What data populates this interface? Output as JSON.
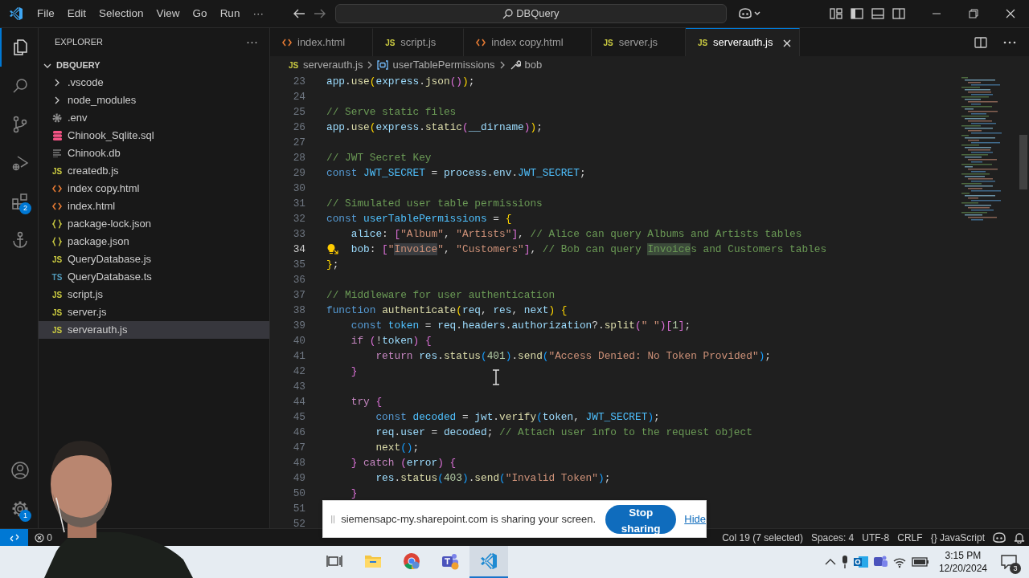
{
  "title_bar": {
    "menu": [
      "File",
      "Edit",
      "Selection",
      "View",
      "Go",
      "Run",
      "···"
    ],
    "search": "DBQuery"
  },
  "activity_bar": {
    "items": [
      {
        "kind": "files",
        "selected": true
      },
      {
        "kind": "search",
        "selected": false
      },
      {
        "kind": "source-control",
        "selected": false
      },
      {
        "kind": "run-debug",
        "selected": false
      },
      {
        "kind": "extensions",
        "selected": false,
        "badge": "2"
      },
      {
        "kind": "anchor",
        "selected": false
      }
    ],
    "bottom": [
      {
        "kind": "account"
      },
      {
        "kind": "settings",
        "badge": "1"
      }
    ]
  },
  "sidebar": {
    "title": "EXPLORER",
    "more": "···",
    "folder": {
      "name": "DBQUERY",
      "expanded": true,
      "children": [
        {
          "kind": "folder",
          "name": ".vscode",
          "expanded": false,
          "selected": false
        },
        {
          "kind": "folder",
          "name": "node_modules",
          "expanded": false,
          "selected": false
        },
        {
          "kind": "gear",
          "name": ".env",
          "selected": false
        },
        {
          "kind": "database",
          "name": "Chinook_Sqlite.sql",
          "selected": false
        },
        {
          "kind": "lines",
          "name": "Chinook.db",
          "selected": false
        },
        {
          "kind": "js",
          "badge": "JS",
          "name": "createdb.js",
          "selected": false
        },
        {
          "kind": "html",
          "name": "index copy.html",
          "selected": false
        },
        {
          "kind": "html",
          "name": "index.html",
          "selected": false
        },
        {
          "kind": "json",
          "name": "package-lock.json",
          "selected": false
        },
        {
          "kind": "json",
          "name": "package.json",
          "selected": false
        },
        {
          "kind": "js",
          "badge": "JS",
          "name": "QueryDatabase.js",
          "selected": false
        },
        {
          "kind": "ts",
          "badge": "TS",
          "name": "QueryDatabase.ts",
          "selected": false
        },
        {
          "kind": "js",
          "badge": "JS",
          "name": "script.js",
          "selected": false
        },
        {
          "kind": "js",
          "badge": "JS",
          "name": "server.js",
          "selected": false
        },
        {
          "kind": "js",
          "badge": "JS",
          "name": "serverauth.js",
          "selected": true
        }
      ]
    }
  },
  "tabs": [
    {
      "kind": "html",
      "name": "index.html",
      "selected": false
    },
    {
      "kind": "js",
      "badge": "JS",
      "name": "script.js",
      "selected": false
    },
    {
      "kind": "html",
      "name": "index copy.html",
      "selected": false
    },
    {
      "kind": "js",
      "badge": "JS",
      "name": "server.js",
      "selected": false
    },
    {
      "kind": "js",
      "badge": "JS",
      "name": "serverauth.js",
      "selected": true
    }
  ],
  "breadcrumbs": [
    {
      "kind": "js",
      "badge": "JS",
      "text": "serverauth.js"
    },
    {
      "kind": "variable",
      "text": "userTablePermissions"
    },
    {
      "kind": "property",
      "text": "bob"
    }
  ],
  "editor": {
    "lines": [
      {
        "number": "23",
        "current": false,
        "lightbulb": false,
        "tokens": [
          {
            "kind": "var",
            "text": "app"
          },
          {
            "kind": "pl",
            "text": "."
          },
          {
            "kind": "fn",
            "text": "use"
          },
          {
            "kind": "b1",
            "text": "("
          },
          {
            "kind": "var",
            "text": "express"
          },
          {
            "kind": "pl",
            "text": "."
          },
          {
            "kind": "fn",
            "text": "json"
          },
          {
            "kind": "b2",
            "text": "()"
          },
          {
            "kind": "b1",
            "text": ")"
          },
          {
            "kind": "pl",
            "text": ";"
          }
        ]
      },
      {
        "number": "24",
        "current": false,
        "lightbulb": false
      },
      {
        "number": "25",
        "current": false,
        "lightbulb": false,
        "tokens": [
          {
            "kind": "cm",
            "text": "// Serve static files"
          }
        ]
      },
      {
        "number": "26",
        "current": false,
        "lightbulb": false,
        "tokens": [
          {
            "kind": "var",
            "text": "app"
          },
          {
            "kind": "pl",
            "text": "."
          },
          {
            "kind": "fn",
            "text": "use"
          },
          {
            "kind": "b1",
            "text": "("
          },
          {
            "kind": "var",
            "text": "express"
          },
          {
            "kind": "pl",
            "text": "."
          },
          {
            "kind": "fn",
            "text": "static"
          },
          {
            "kind": "b2",
            "text": "("
          },
          {
            "kind": "var",
            "text": "__dirname"
          },
          {
            "kind": "b2",
            "text": ")"
          },
          {
            "kind": "b1",
            "text": ")"
          },
          {
            "kind": "pl",
            "text": ";"
          }
        ]
      },
      {
        "number": "27",
        "current": false,
        "lightbulb": false
      },
      {
        "number": "28",
        "current": false,
        "lightbulb": false,
        "tokens": [
          {
            "kind": "cm",
            "text": "// JWT Secret Key"
          }
        ]
      },
      {
        "number": "29",
        "current": false,
        "lightbulb": false,
        "tokens": [
          {
            "kind": "kw",
            "text": "const "
          },
          {
            "kind": "cv",
            "text": "JWT_SECRET"
          },
          {
            "kind": "pl",
            "text": " = "
          },
          {
            "kind": "var",
            "text": "process"
          },
          {
            "kind": "pl",
            "text": "."
          },
          {
            "kind": "var",
            "text": "env"
          },
          {
            "kind": "pl",
            "text": "."
          },
          {
            "kind": "cv",
            "text": "JWT_SECRET"
          },
          {
            "kind": "pl",
            "text": ";"
          }
        ]
      },
      {
        "number": "30",
        "current": false,
        "lightbulb": false
      },
      {
        "number": "31",
        "current": false,
        "lightbulb": false,
        "tokens": [
          {
            "kind": "cm",
            "text": "// Simulated user table permissions"
          }
        ]
      },
      {
        "number": "32",
        "current": false,
        "lightbulb": false,
        "tokens": [
          {
            "kind": "kw",
            "text": "const "
          },
          {
            "kind": "cv",
            "text": "userTablePermissions"
          },
          {
            "kind": "pl",
            "text": " = "
          },
          {
            "kind": "b1",
            "text": "{"
          }
        ]
      },
      {
        "number": "33",
        "current": false,
        "lightbulb": false,
        "tokens": [
          {
            "kind": "var",
            "text": "    alice"
          },
          {
            "kind": "pl",
            "text": ": "
          },
          {
            "kind": "b2",
            "text": "["
          },
          {
            "kind": "str",
            "text": "\"Album\""
          },
          {
            "kind": "pl",
            "text": ", "
          },
          {
            "kind": "str",
            "text": "\"Artists\""
          },
          {
            "kind": "b2",
            "text": "]"
          },
          {
            "kind": "pl",
            "text": ", "
          },
          {
            "kind": "cm",
            "text": "// Alice can query Albums and Artists tables"
          }
        ]
      },
      {
        "number": "34",
        "current": true,
        "lightbulb": true,
        "tokens": [
          {
            "kind": "var",
            "text": "    bob"
          },
          {
            "kind": "pl",
            "text": ": "
          },
          {
            "kind": "b2",
            "text": "["
          },
          {
            "kind": "str",
            "text": "\""
          },
          {
            "kind": "sel",
            "text": "Invoice"
          },
          {
            "kind": "str",
            "text": "\""
          },
          {
            "kind": "pl",
            "text": ", "
          },
          {
            "kind": "str",
            "text": "\"Customers\""
          },
          {
            "kind": "b2",
            "text": "]"
          },
          {
            "kind": "pl",
            "text": ", "
          },
          {
            "kind": "cm",
            "text": "// Bob can query "
          },
          {
            "kind": "match",
            "text": "Invoice"
          },
          {
            "kind": "cm",
            "text": "s and Customers tables"
          }
        ]
      },
      {
        "number": "35",
        "current": false,
        "lightbulb": false,
        "tokens": [
          {
            "kind": "b1",
            "text": "}"
          },
          {
            "kind": "pl",
            "text": ";"
          }
        ]
      },
      {
        "number": "36",
        "current": false,
        "lightbulb": false
      },
      {
        "number": "37",
        "current": false,
        "lightbulb": false,
        "tokens": [
          {
            "kind": "cm",
            "text": "// Middleware for user authentication"
          }
        ]
      },
      {
        "number": "38",
        "current": false,
        "lightbulb": false,
        "tokens": [
          {
            "kind": "kw",
            "text": "function "
          },
          {
            "kind": "fn",
            "text": "authenticate"
          },
          {
            "kind": "b1",
            "text": "("
          },
          {
            "kind": "var",
            "text": "req"
          },
          {
            "kind": "pl",
            "text": ", "
          },
          {
            "kind": "var",
            "text": "res"
          },
          {
            "kind": "pl",
            "text": ", "
          },
          {
            "kind": "var",
            "text": "next"
          },
          {
            "kind": "b1",
            "text": ")"
          },
          {
            "kind": "b1",
            "text": " {"
          }
        ]
      },
      {
        "number": "39",
        "current": false,
        "lightbulb": false,
        "tokens": [
          {
            "kind": "kw",
            "text": "    const "
          },
          {
            "kind": "cv",
            "text": "token"
          },
          {
            "kind": "pl",
            "text": " = "
          },
          {
            "kind": "var",
            "text": "req"
          },
          {
            "kind": "pl",
            "text": "."
          },
          {
            "kind": "var",
            "text": "headers"
          },
          {
            "kind": "pl",
            "text": "."
          },
          {
            "kind": "var",
            "text": "authorization"
          },
          {
            "kind": "pl",
            "text": "?."
          },
          {
            "kind": "fn",
            "text": "split"
          },
          {
            "kind": "b2",
            "text": "("
          },
          {
            "kind": "str",
            "text": "\" \""
          },
          {
            "kind": "b2",
            "text": ")"
          },
          {
            "kind": "b2",
            "text": "["
          },
          {
            "kind": "num",
            "text": "1"
          },
          {
            "kind": "b2",
            "text": "]"
          },
          {
            "kind": "pl",
            "text": ";"
          }
        ]
      },
      {
        "number": "40",
        "current": false,
        "lightbulb": false,
        "tokens": [
          {
            "kind": "ctl",
            "text": "    if "
          },
          {
            "kind": "b2",
            "text": "("
          },
          {
            "kind": "pl",
            "text": "!"
          },
          {
            "kind": "var",
            "text": "token"
          },
          {
            "kind": "b2",
            "text": ")"
          },
          {
            "kind": "b2",
            "text": " {"
          }
        ]
      },
      {
        "number": "41",
        "current": false,
        "lightbulb": false,
        "tokens": [
          {
            "kind": "ctl",
            "text": "        return "
          },
          {
            "kind": "var",
            "text": "res"
          },
          {
            "kind": "pl",
            "text": "."
          },
          {
            "kind": "fn",
            "text": "status"
          },
          {
            "kind": "b3",
            "text": "("
          },
          {
            "kind": "num",
            "text": "401"
          },
          {
            "kind": "b3",
            "text": ")"
          },
          {
            "kind": "pl",
            "text": "."
          },
          {
            "kind": "fn",
            "text": "send"
          },
          {
            "kind": "b3",
            "text": "("
          },
          {
            "kind": "str",
            "text": "\"Access Denied: No Token Provided\""
          },
          {
            "kind": "b3",
            "text": ")"
          },
          {
            "kind": "pl",
            "text": ";"
          }
        ]
      },
      {
        "number": "42",
        "current": false,
        "lightbulb": false,
        "tokens": [
          {
            "kind": "b2",
            "text": "    }"
          }
        ]
      },
      {
        "number": "43",
        "current": false,
        "lightbulb": false
      },
      {
        "number": "44",
        "current": false,
        "lightbulb": false,
        "tokens": [
          {
            "kind": "ctl",
            "text": "    try "
          },
          {
            "kind": "b2",
            "text": "{"
          }
        ]
      },
      {
        "number": "45",
        "current": false,
        "lightbulb": false,
        "tokens": [
          {
            "kind": "kw",
            "text": "        const "
          },
          {
            "kind": "cv",
            "text": "decoded"
          },
          {
            "kind": "pl",
            "text": " = "
          },
          {
            "kind": "var",
            "text": "jwt"
          },
          {
            "kind": "pl",
            "text": "."
          },
          {
            "kind": "fn",
            "text": "verify"
          },
          {
            "kind": "b3",
            "text": "("
          },
          {
            "kind": "var",
            "text": "token"
          },
          {
            "kind": "pl",
            "text": ", "
          },
          {
            "kind": "cv",
            "text": "JWT_SECRET"
          },
          {
            "kind": "b3",
            "text": ")"
          },
          {
            "kind": "pl",
            "text": ";"
          }
        ]
      },
      {
        "number": "46",
        "current": false,
        "lightbulb": false,
        "tokens": [
          {
            "kind": "var",
            "text": "        req"
          },
          {
            "kind": "pl",
            "text": "."
          },
          {
            "kind": "var",
            "text": "user"
          },
          {
            "kind": "pl",
            "text": " = "
          },
          {
            "kind": "var",
            "text": "decoded"
          },
          {
            "kind": "pl",
            "text": "; "
          },
          {
            "kind": "cm",
            "text": "// Attach user info to the request object"
          }
        ]
      },
      {
        "number": "47",
        "current": false,
        "lightbulb": false,
        "tokens": [
          {
            "kind": "fn",
            "text": "        next"
          },
          {
            "kind": "b3",
            "text": "()"
          },
          {
            "kind": "pl",
            "text": ";"
          }
        ]
      },
      {
        "number": "48",
        "current": false,
        "lightbulb": false,
        "tokens": [
          {
            "kind": "b2",
            "text": "    } "
          },
          {
            "kind": "ctl",
            "text": "catch "
          },
          {
            "kind": "b2",
            "text": "("
          },
          {
            "kind": "var",
            "text": "error"
          },
          {
            "kind": "b2",
            "text": ")"
          },
          {
            "kind": "b2",
            "text": " {"
          }
        ]
      },
      {
        "number": "49",
        "current": false,
        "lightbulb": false,
        "tokens": [
          {
            "kind": "var",
            "text": "        res"
          },
          {
            "kind": "pl",
            "text": "."
          },
          {
            "kind": "fn",
            "text": "status"
          },
          {
            "kind": "b3",
            "text": "("
          },
          {
            "kind": "num",
            "text": "403"
          },
          {
            "kind": "b3",
            "text": ")"
          },
          {
            "kind": "pl",
            "text": "."
          },
          {
            "kind": "fn",
            "text": "send"
          },
          {
            "kind": "b3",
            "text": "("
          },
          {
            "kind": "str",
            "text": "\"Invalid Token\""
          },
          {
            "kind": "b3",
            "text": ")"
          },
          {
            "kind": "pl",
            "text": ";"
          }
        ]
      },
      {
        "number": "50",
        "current": false,
        "lightbulb": false,
        "tokens": [
          {
            "kind": "b2",
            "text": "    }"
          }
        ]
      },
      {
        "number": "51",
        "current": false,
        "lightbulb": false
      },
      {
        "number": "52",
        "current": false,
        "lightbulb": false
      }
    ]
  },
  "notification": {
    "message": "siemensapc-my.sharepoint.com is sharing your screen.",
    "button": "Stop sharing",
    "link": "Hide"
  },
  "status_bar": {
    "errors": "0",
    "items": [
      "Col 19 (7 selected)",
      "Spaces: 4",
      "UTF-8",
      "CRLF"
    ],
    "language": {
      "icon": "{}",
      "name": "JavaScript"
    }
  },
  "taskbar": {
    "apps": [
      {
        "kind": "task-view",
        "selected": false
      },
      {
        "kind": "folder",
        "selected": false
      },
      {
        "kind": "chrome",
        "selected": false
      },
      {
        "kind": "teams",
        "selected": false
      },
      {
        "kind": "vscode",
        "selected": true
      }
    ],
    "time": "3:15 PM",
    "date": "12/20/2024",
    "notifications": "3"
  }
}
